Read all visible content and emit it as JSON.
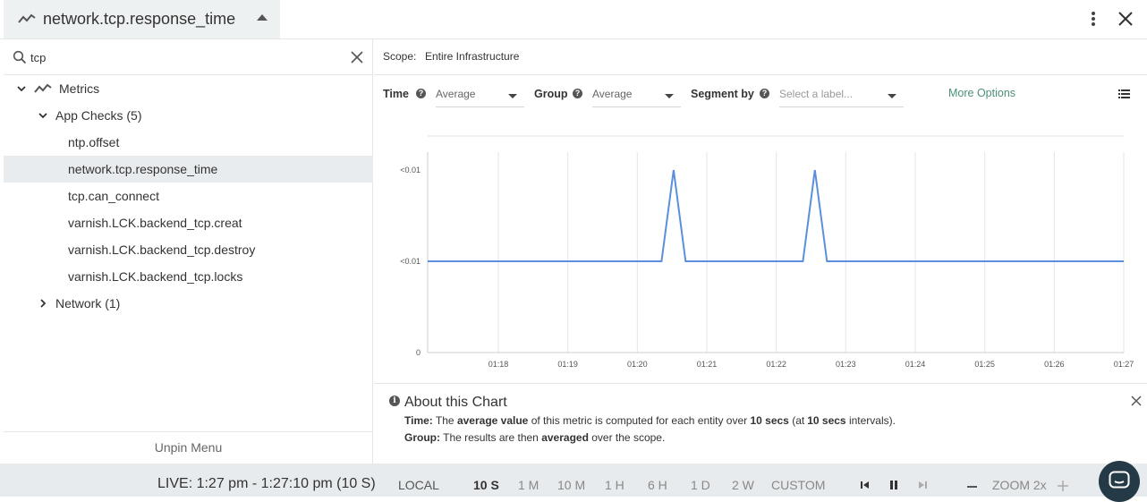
{
  "header": {
    "title": "network.tcp.response_time"
  },
  "sidebar": {
    "search": {
      "value": "tcp",
      "placeholder": ""
    },
    "tree": {
      "metrics_label": "Metrics",
      "app_checks_label": "App Checks (5)",
      "items": [
        "ntp.offset",
        "network.tcp.response_time",
        "tcp.can_connect",
        "varnish.LCK.backend_tcp.creat",
        "varnish.LCK.backend_tcp.destroy",
        "varnish.LCK.backend_tcp.locks"
      ],
      "selected_index": 1,
      "network_label": "Network (1)"
    },
    "unpin_label": "Unpin Menu"
  },
  "scope": {
    "label": "Scope:",
    "value": "Entire Infrastructure"
  },
  "controls": {
    "time_label": "Time",
    "time_value": "Average",
    "group_label": "Group",
    "group_value": "Average",
    "segment_label": "Segment by",
    "segment_placeholder": "Select a label...",
    "more_options": "More Options"
  },
  "chart_data": {
    "type": "line",
    "x_ticks": [
      "01:18",
      "01:19",
      "01:20",
      "01:21",
      "01:22",
      "01:23",
      "01:24",
      "01:25",
      "01:26",
      "01:27"
    ],
    "y_ticks": [
      "0",
      "<0.01",
      "<0.01"
    ],
    "series": [
      {
        "color": "#5b8fde",
        "x_minutes": [
          1,
          4.31,
          4.48,
          4.65,
          6.31,
          6.48,
          6.65,
          10.85
        ],
        "values": [
          1,
          1,
          2,
          1,
          1,
          2,
          1,
          1
        ]
      }
    ],
    "x_range_minutes": [
      1,
      10.85
    ],
    "y_range": [
      0,
      2
    ],
    "grid": true
  },
  "about": {
    "title": "About this Chart",
    "time_label": "Time:",
    "time_text_1": "The",
    "time_bold_1": "average value",
    "time_text_2": "of this metric is computed for each entity over",
    "time_bold_2": "10 secs",
    "time_text_3": "(at",
    "time_bold_3": "10 secs",
    "time_text_4": "intervals).",
    "group_label": "Group:",
    "group_text_1": "The results are then",
    "group_bold": "averaged",
    "group_text_2": "over the scope."
  },
  "footer": {
    "live": "LIVE: 1:27 pm - 1:27:10 pm (10 S)",
    "local": "LOCAL",
    "ranges": [
      "10 S",
      "1 M",
      "10 M",
      "1 H",
      "6 H",
      "1 D",
      "2 W",
      "CUSTOM"
    ],
    "active_range": "10 S",
    "zoom": "ZOOM 2x"
  },
  "colors": {
    "accent": "#4c8f79",
    "line": "#5b8fde",
    "selected_row": "#e9ecee",
    "footer_bg": "#e8ebed",
    "chat_button": "#243a47"
  }
}
